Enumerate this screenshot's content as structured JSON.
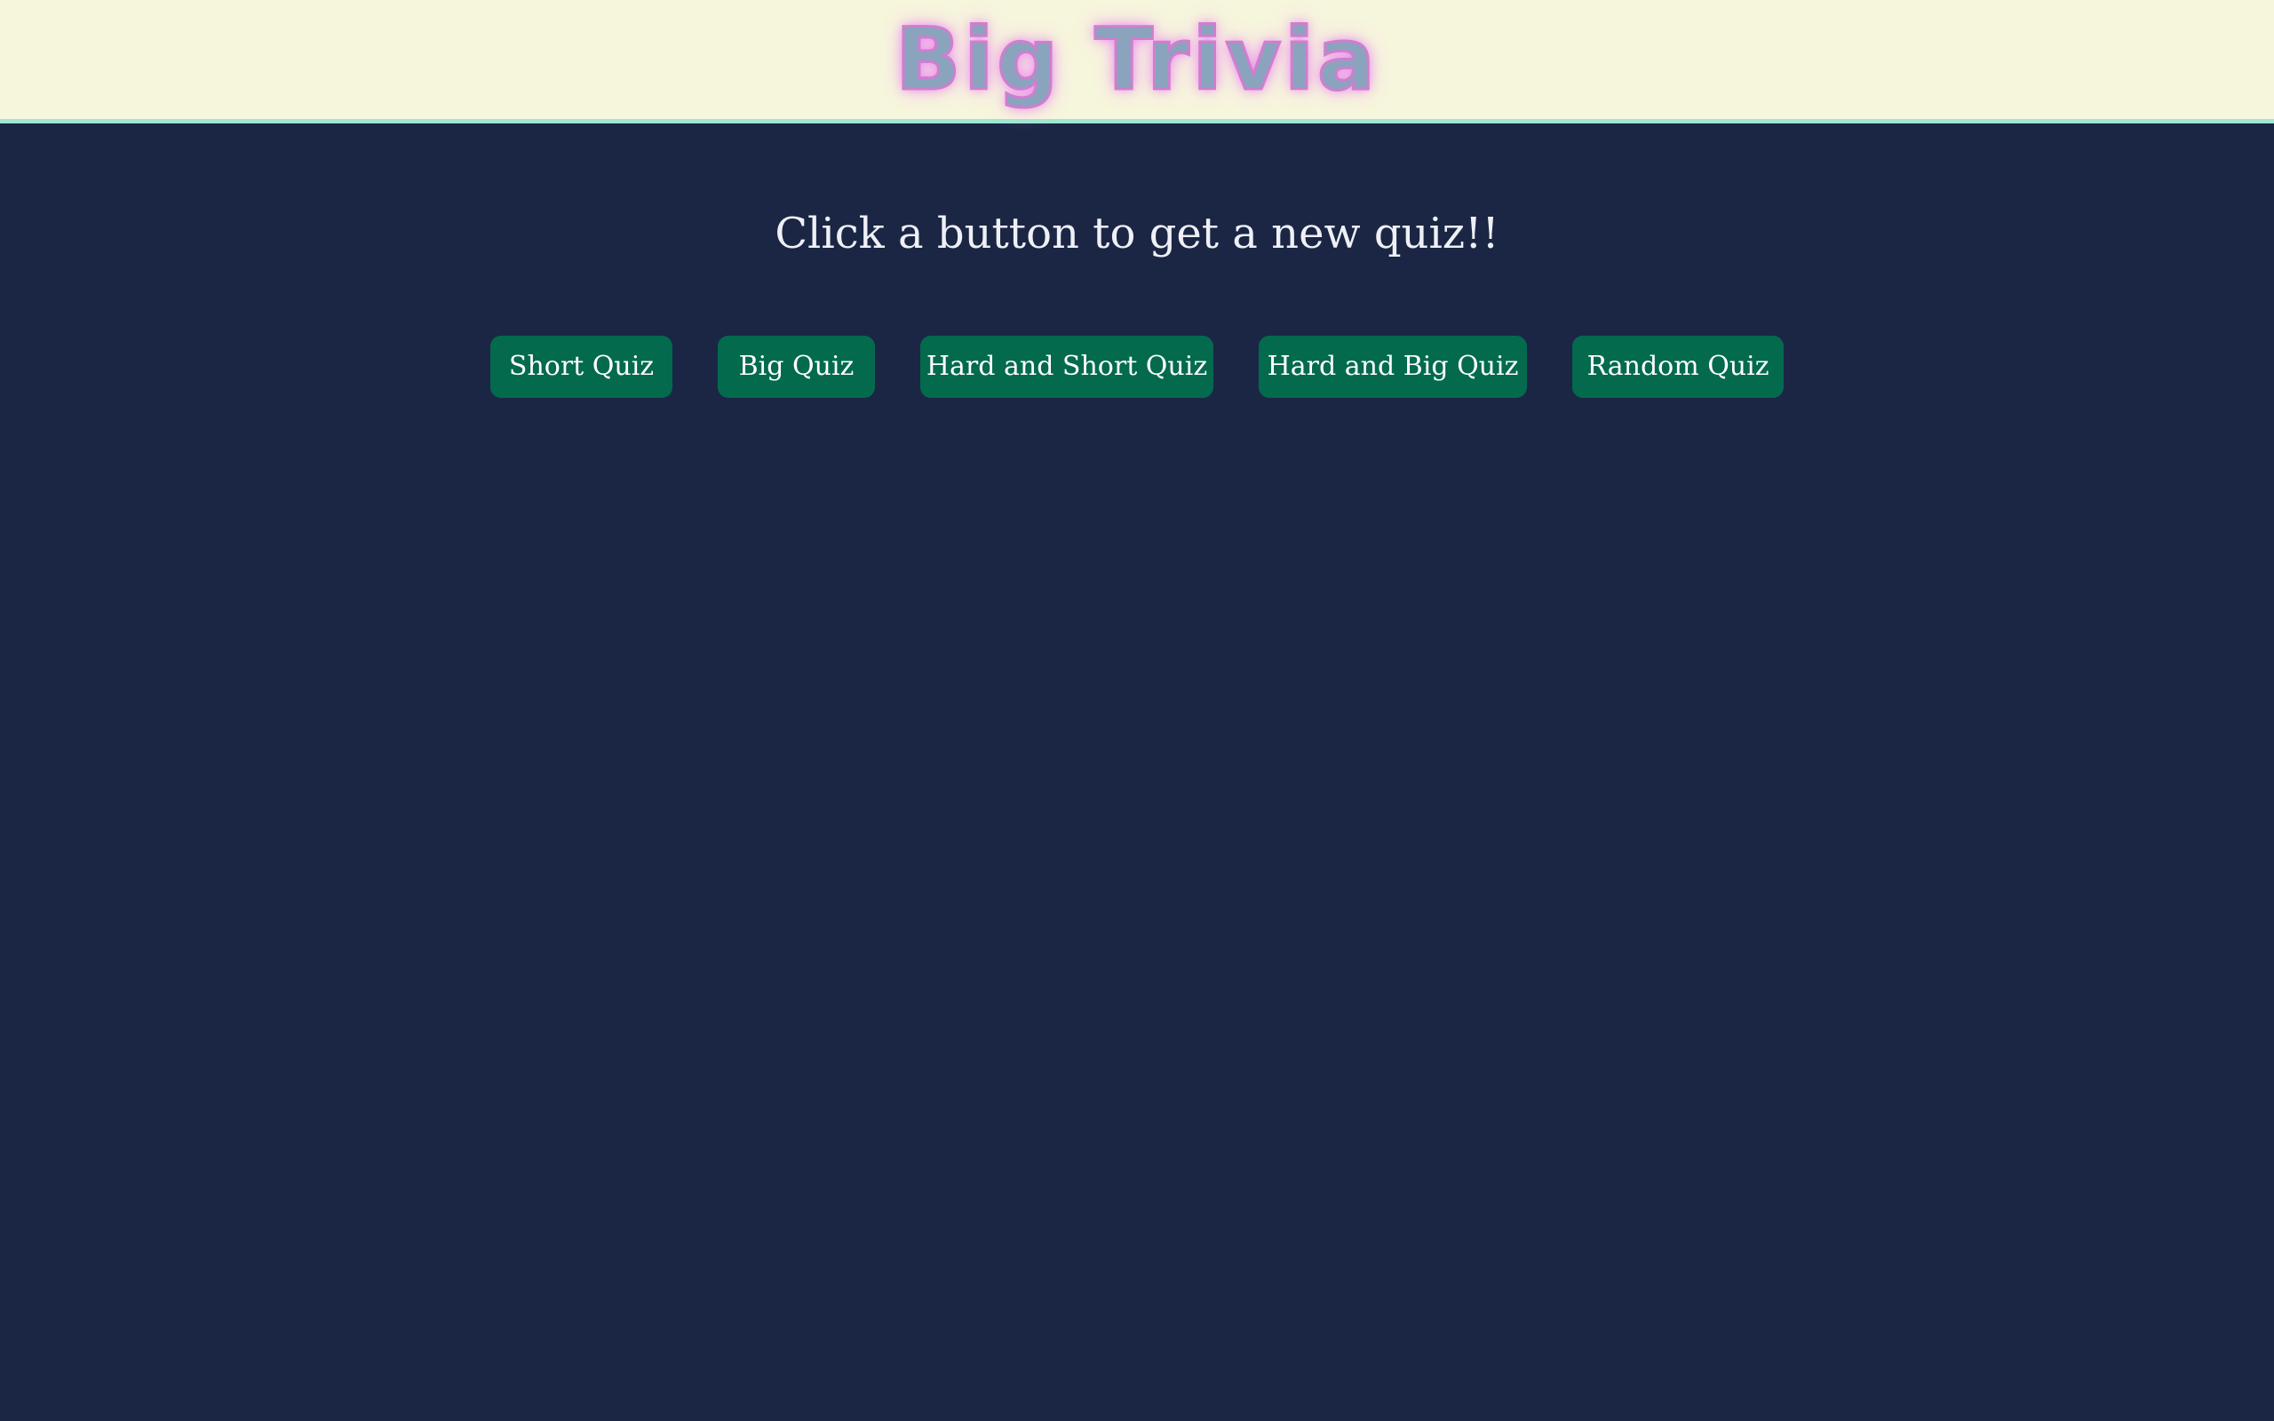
{
  "header": {
    "title": "Big Trivia"
  },
  "main": {
    "prompt": "Click a button to get a new quiz!!",
    "buttons": [
      {
        "label": "Short Quiz"
      },
      {
        "label": "Big Quiz"
      },
      {
        "label": "Hard and Short Quiz"
      },
      {
        "label": "Hard and Big Quiz"
      },
      {
        "label": "Random Quiz"
      }
    ]
  },
  "colors": {
    "header_background": "#f6f6dc",
    "header_border": "#9de8d4",
    "title_fill": "#8aa4bd",
    "title_glow": "#e98be9",
    "page_background": "#1b2645",
    "button_background": "#036a4e",
    "button_text": "#ffffff",
    "prompt_text": "#eef0f5"
  }
}
